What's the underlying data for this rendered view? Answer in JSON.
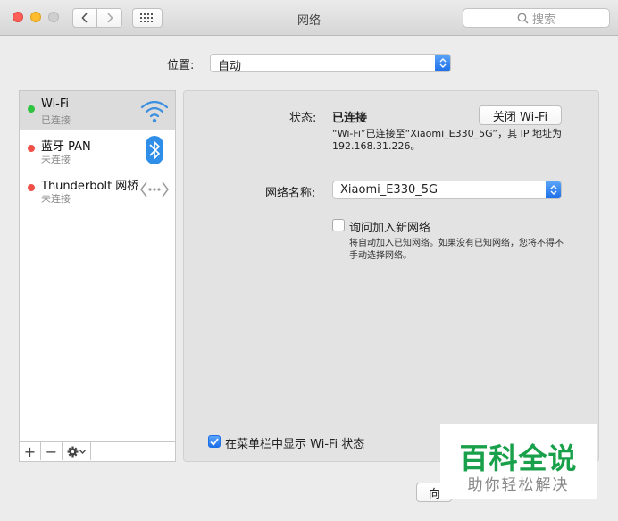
{
  "window": {
    "title": "网络"
  },
  "toolbar": {
    "search_placeholder": "搜索"
  },
  "location": {
    "label": "位置:",
    "value": "自动"
  },
  "services": [
    {
      "name": "Wi-Fi",
      "status": "已连接",
      "dot_color": "#2fc33f",
      "icon": "wifi-icon"
    },
    {
      "name": "蓝牙 PAN",
      "status": "未连接",
      "dot_color": "#ee4f46",
      "icon": "bluetooth-icon"
    },
    {
      "name": "Thunderbolt 网桥",
      "status": "未连接",
      "dot_color": "#ee4f46",
      "icon": "thunderbolt-bridge-icon"
    }
  ],
  "sidebar_tools": {
    "add": "+",
    "remove": "−"
  },
  "detail": {
    "status_label": "状态:",
    "status_value": "已连接",
    "turn_off_button": "关闭 Wi-Fi",
    "status_desc": "“Wi-Fi”已连接至“Xiaomi_E330_5G”，其 IP 地址为 192.168.31.226。",
    "network_name_label": "网络名称:",
    "network_name_value": "Xiaomi_E330_5G",
    "ask_join_label": "询问加入新网络",
    "ask_join_checked": false,
    "ask_join_desc": "将自动加入已知网络。如果没有已知网络，您将不得不手动选择网络。",
    "show_menubar_label": "在菜单栏中显示 Wi-Fi 状态",
    "show_menubar_checked": true
  },
  "watermark": {
    "main": "百科全说",
    "sub": "助你轻松解决"
  },
  "footer": {
    "partial_button": "向"
  },
  "colors": {
    "accent": "#1d6fe8",
    "connected": "#2fc33f",
    "disconnected": "#ee4f46",
    "watermark": "#19a04a"
  }
}
